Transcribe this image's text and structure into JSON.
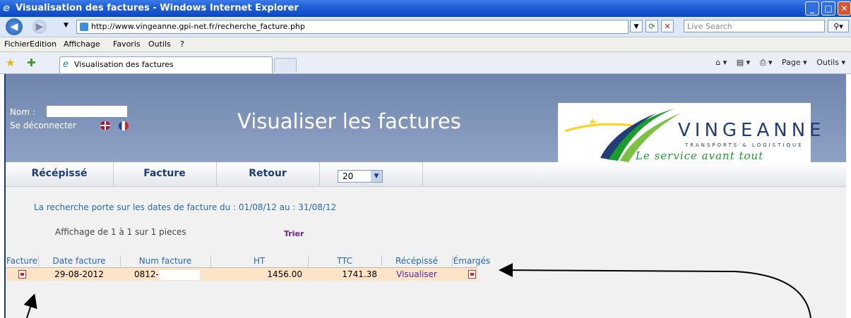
{
  "window": {
    "title": "Visualisation des factures - Windows Internet Explorer",
    "url": "http://www.vingeanne.gpi-net.fr/recherche_facture.php",
    "search_placeholder": "Live Search"
  },
  "menu": [
    "Fichier",
    "Edition",
    "Affichage",
    "Favoris",
    "Outils",
    "?"
  ],
  "tab": {
    "label": "Visualisation des factures"
  },
  "command_bar": {
    "page": "Page ▾",
    "outils": "Outils ▾"
  },
  "header": {
    "nom_label": "Nom :",
    "logout": "Se déconnecter",
    "title": "Visualiser les factures"
  },
  "logo": {
    "name": "VINGEANNE",
    "subtitle": "TRANSPORTS & LOGISTIQUE",
    "slogan": "Le service avant tout"
  },
  "nav": {
    "items": [
      "Récépissé",
      "Facture",
      "Retour"
    ],
    "per_page": "20"
  },
  "search_info": "La recherche porte sur les dates de facture du : 01/08/12 au : 31/08/12",
  "display_count": "Affichage de 1 à 1 sur 1 pieces",
  "sort_label": "Trier",
  "table": {
    "headers": [
      "Facture",
      "Date facture",
      "Num facture",
      "HT",
      "TTC",
      "Récépissé",
      "Émargés"
    ],
    "rows": [
      {
        "date": "29-08-2012",
        "num": "0812-",
        "ht": "1456.00",
        "ttc": "1741.38",
        "recepisse": "Visualiser"
      }
    ]
  },
  "colors": {
    "header": "#7b90b6",
    "nav_text": "#1c3c7a",
    "row": "#fde4c6",
    "link": "#6b2285"
  }
}
